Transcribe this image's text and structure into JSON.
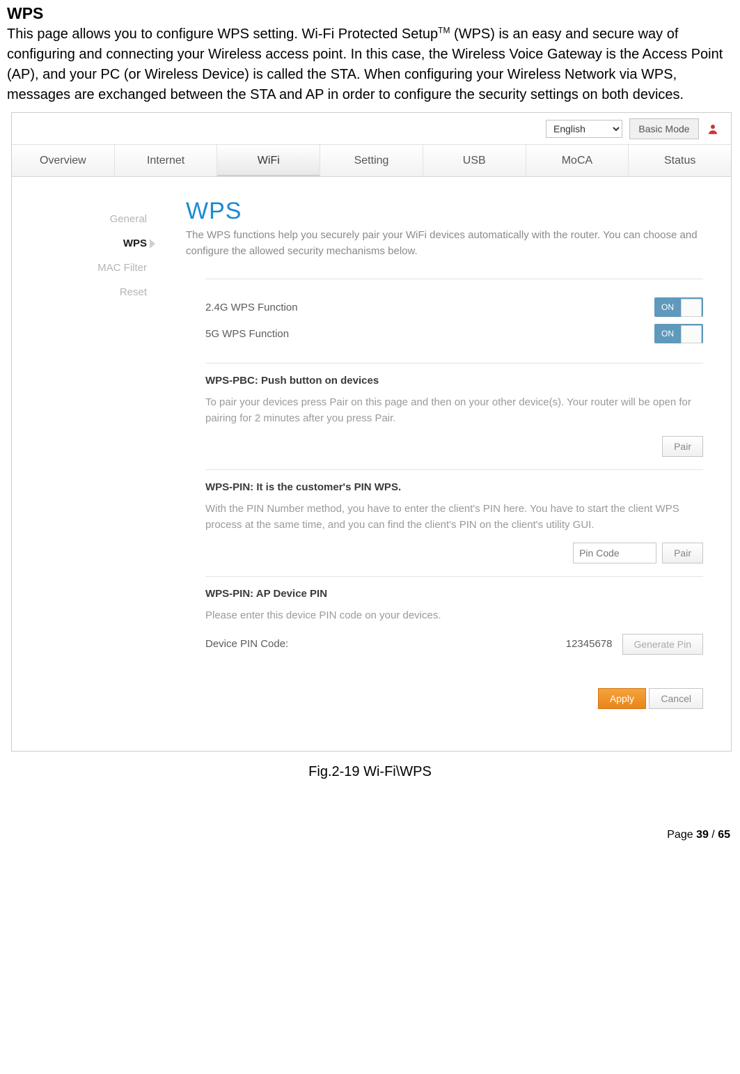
{
  "doc": {
    "title": "WPS",
    "paragraph_before_sup": "This page allows you to configure WPS setting. Wi-Fi Protected Setup",
    "sup": "TM",
    "paragraph_after_sup": " (WPS) is an easy and secure  way of configuring and connecting your Wireless access point. In this case, the Wireless Voice Gateway  is the Access Point (AP), and your PC (or Wireless Device) is called the STA. When configuring your  Wireless Network via WPS, messages are exchanged between the STA and AP in order to configure the  security settings on both devices.",
    "caption": "Fig.2-19 Wi-Fi\\WPS",
    "page_label": "Page ",
    "page_current": "39",
    "page_sep": " / ",
    "page_total": "65"
  },
  "topbar": {
    "language": "English",
    "mode_button": "Basic Mode"
  },
  "nav": {
    "items": [
      "Overview",
      "Internet",
      "WiFi",
      "Setting",
      "USB",
      "MoCA",
      "Status"
    ],
    "active_index": 2
  },
  "sidebar": {
    "items": [
      "General",
      "WPS",
      "MAC Filter",
      "Reset"
    ],
    "active_index": 1
  },
  "content": {
    "title": "WPS",
    "subtitle": "The WPS functions help you securely pair your WiFi devices automatically with the router. You can choose and configure the allowed security mechanisms below.",
    "toggles": [
      {
        "label": "2.4G WPS Function",
        "state": "ON"
      },
      {
        "label": "5G WPS Function",
        "state": "ON"
      }
    ],
    "pbc": {
      "title": "WPS-PBC: Push button on devices",
      "desc": "To pair your devices press Pair on this page and then on your other device(s). Your router will be open for pairing for 2 minutes after you press Pair.",
      "button": "Pair"
    },
    "pin_client": {
      "title": "WPS-PIN: It is the customer's PIN WPS.",
      "desc": "With the PIN Number method, you have to enter the client's PIN here. You have to start the client WPS process at the same time, and you can find the client's PIN on the client's utility GUI.",
      "placeholder": "Pin Code",
      "button": "Pair"
    },
    "pin_ap": {
      "title": "WPS-PIN: AP Device PIN",
      "desc": "Please enter this device PIN code on your devices.",
      "label": "Device PIN Code:",
      "value": "12345678",
      "button": "Generate Pin"
    },
    "actions": {
      "apply": "Apply",
      "cancel": "Cancel"
    }
  }
}
